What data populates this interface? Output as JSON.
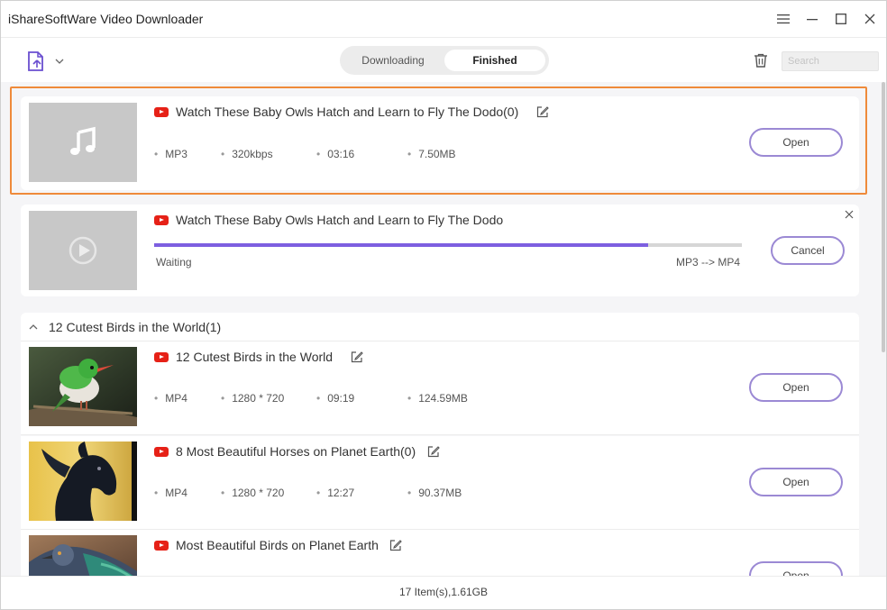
{
  "app": {
    "title": "iShareSoftWare Video Downloader"
  },
  "window_controls": {
    "menu_icon": "hamburger-icon",
    "minimize_icon": "minimize-icon",
    "maximize_icon": "maximize-icon",
    "close_icon": "close-icon"
  },
  "toolbar": {
    "tabs": [
      {
        "label": "Downloading",
        "active": false
      },
      {
        "label": "Finished",
        "active": true
      }
    ],
    "search": {
      "placeholder": "Search",
      "value": ""
    }
  },
  "colors": {
    "accent": "#7d5fe0",
    "button_border": "#9b89d4",
    "selected_border": "#ef8a3a",
    "youtube": "#e62117"
  },
  "items": [
    {
      "title": "Watch These Baby Owls Hatch and Learn to Fly  The Dodo(0)",
      "format": "MP3",
      "quality": "320kbps",
      "duration": "03:16",
      "size": "7.50MB",
      "action": "Open",
      "thumbnail": "music-note-icon",
      "selected": true
    }
  ],
  "converting": {
    "title": "Watch These Baby Owls Hatch and Learn to Fly  The Dodo",
    "status": "Waiting",
    "conversion": "MP3 --> MP4",
    "progress_percent": 84,
    "action": "Cancel",
    "thumbnail": "video-play-icon"
  },
  "group": {
    "label": "12 Cutest Birds in the World(1)",
    "items": [
      {
        "title": "12 Cutest Birds in the World",
        "format": "MP4",
        "resolution": "1280 * 720",
        "duration": "09:19",
        "size": "124.59MB",
        "action": "Open",
        "thumbnail": "bird-photo"
      }
    ]
  },
  "more_items": [
    {
      "title": "8 Most Beautiful Horses on Planet Earth(0)",
      "format": "MP4",
      "resolution": "1280 * 720",
      "duration": "12:27",
      "size": "90.37MB",
      "action": "Open",
      "thumbnail": "horse-photo"
    },
    {
      "title": "Most Beautiful Birds on Planet Earth",
      "action": "Open",
      "thumbnail": "pigeon-photo"
    }
  ],
  "status": {
    "summary": "17 Item(s),1.61GB"
  }
}
